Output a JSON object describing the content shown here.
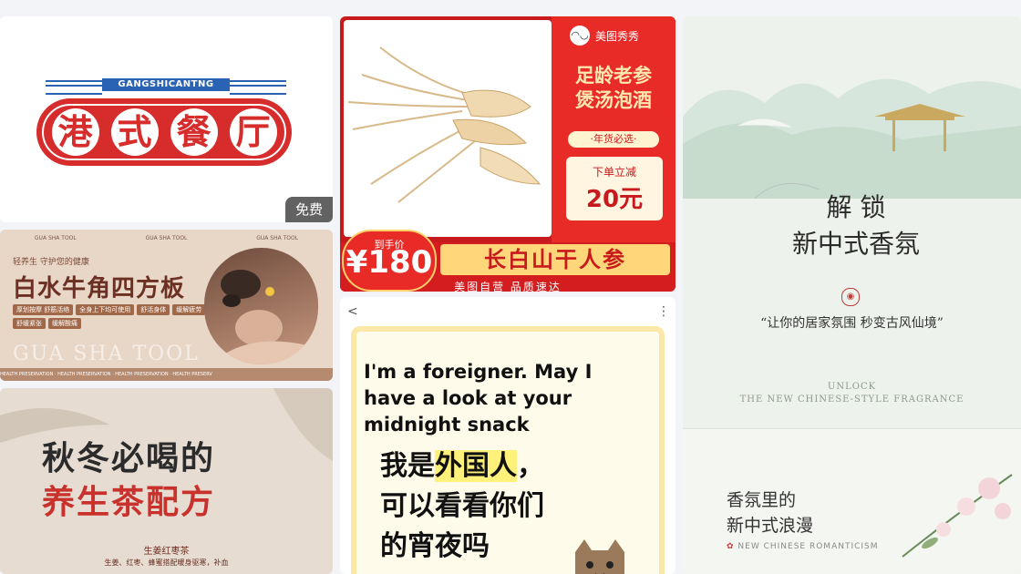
{
  "cards": {
    "hk_restaurant": {
      "logo_subtitle": "GANGSHICANTNG",
      "logo_chars": [
        "港",
        "式",
        "餐",
        "厅"
      ],
      "badge": "免费"
    },
    "ginseng": {
      "brand": "美图秀秀",
      "title_line1": "足龄老参",
      "title_line2": "煲汤泡酒",
      "tag": "·年货必选·",
      "coupon_label": "下单立减",
      "coupon_value": "20元",
      "price_label": "到手价",
      "price_value": "¥180",
      "product_name": "长白山干人参",
      "slogan": "美图自营  品质速达"
    },
    "fragrance": {
      "title_line1": "解   锁",
      "title_line2": "新中式香氛",
      "quote": "“让你的居家氛围  秒变古风仙境”",
      "unlock_en_line1": "UNLOCK",
      "unlock_en_line2": "THE NEW CHINESE-STYLE FRAGRANCE",
      "romance_line1": "香氛里的",
      "romance_line2": "新中式浪漫",
      "romance_en": "NEW CHINESE ROMANTICISM"
    },
    "gua_sha": {
      "top_labels": [
        "GUA SHA TOOL",
        "GUA SHA TOOL",
        "GUA SHA TOOL"
      ],
      "subtitle": "轻养生 守护您的健康",
      "title": "白水牛角四方板",
      "pills": [
        "厚划按摩 舒筋活络",
        "全身上下均可使用",
        "舒活身体",
        "缓解疲劳",
        "舒缓紧张",
        "缓解酸痛"
      ],
      "english": "GUA SHA TOOL",
      "bottom_band": "HEALTH PRESERVATION · HEALTH PRESERVATION · HEALTH PRESERVATION · HEALTH PRESERV"
    },
    "tea": {
      "line1": "秋冬必喝的",
      "line2": "养生茶配方",
      "name": "生姜红枣茶",
      "desc": "生姜、红枣、蜂蜜搭配暖身驱寒，补血"
    },
    "foreigner": {
      "back": "<",
      "more": "⋮",
      "english": "I'm a foreigner. May I have a look at your midnight snack",
      "cn_line1_pre": "我是",
      "cn_line1_hl": "外国人",
      "cn_line1_post": "，",
      "cn_line2": "可以看看你们",
      "cn_line3": "的宵夜吗"
    }
  }
}
